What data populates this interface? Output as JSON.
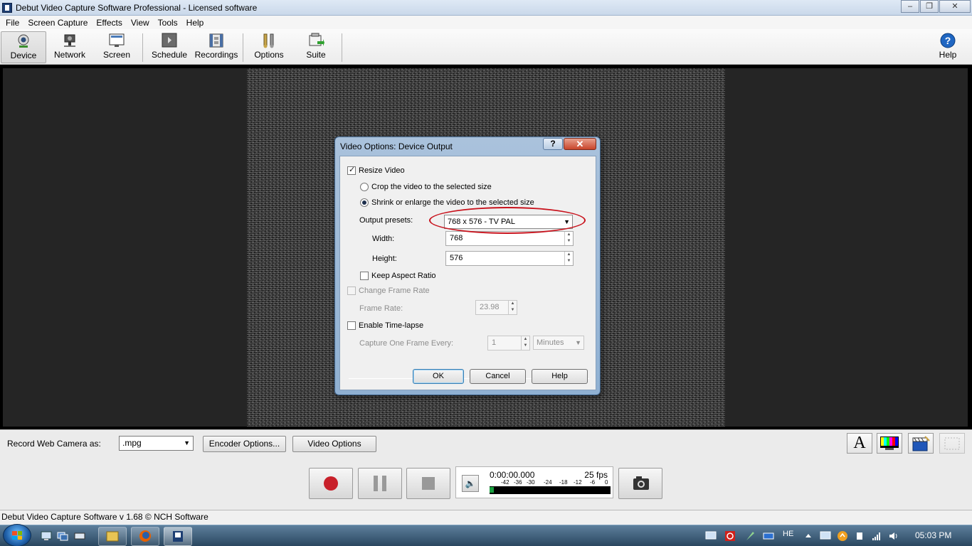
{
  "window": {
    "title": "Debut Video Capture Software Professional - Licensed software",
    "minimize": "‒",
    "maximize": "❐",
    "close": "✕"
  },
  "menu": [
    "File",
    "Screen Capture",
    "Effects",
    "View",
    "Tools",
    "Help"
  ],
  "toolbar": {
    "device": "Device",
    "network": "Network",
    "screen": "Screen",
    "schedule": "Schedule",
    "recordings": "Recordings",
    "options": "Options",
    "suite": "Suite",
    "help": "Help"
  },
  "dialog": {
    "title": "Video Options: Device Output",
    "help_glyph": "?",
    "close_glyph": "✕",
    "resize_video": {
      "label": "Resize Video",
      "checked": true
    },
    "crop_option": {
      "label": "Crop the video to the selected size",
      "checked": false
    },
    "shrink_option": {
      "label": "Shrink or enlarge the video to the selected size",
      "checked": true
    },
    "output_presets": {
      "label": "Output presets:",
      "value": "768 x 576 - TV PAL"
    },
    "width": {
      "label": "Width:",
      "value": "768"
    },
    "height": {
      "label": "Height:",
      "value": "576"
    },
    "keep_aspect": {
      "label": "Keep Aspect Ratio",
      "checked": false
    },
    "change_frame_rate": {
      "label": "Change Frame Rate",
      "checked": false,
      "enabled": false
    },
    "frame_rate": {
      "label": "Frame Rate:",
      "value": "23.98"
    },
    "enable_timelapse": {
      "label": "Enable Time-lapse",
      "checked": false
    },
    "capture_every": {
      "label": "Capture One Frame Every:",
      "value": "1",
      "unit": "Minutes"
    },
    "ok": "OK",
    "cancel": "Cancel",
    "help": "Help",
    "highlight_color": "#c8121c"
  },
  "bottom": {
    "record_label": "Record Web Camera as:",
    "format": ".mpg",
    "encoder_options": "Encoder Options...",
    "video_options": "Video Options",
    "time": "0:00:00.000",
    "fps": "25 fps",
    "meter_scale": [
      "-42",
      "-36",
      "-30",
      "-24",
      "-18",
      "-12",
      "-6",
      "0"
    ],
    "text_tool": "A"
  },
  "status": "Debut Video Capture Software v 1.68 © NCH Software",
  "taskbar": {
    "lang": "HE",
    "clock": "05:03 PM"
  }
}
